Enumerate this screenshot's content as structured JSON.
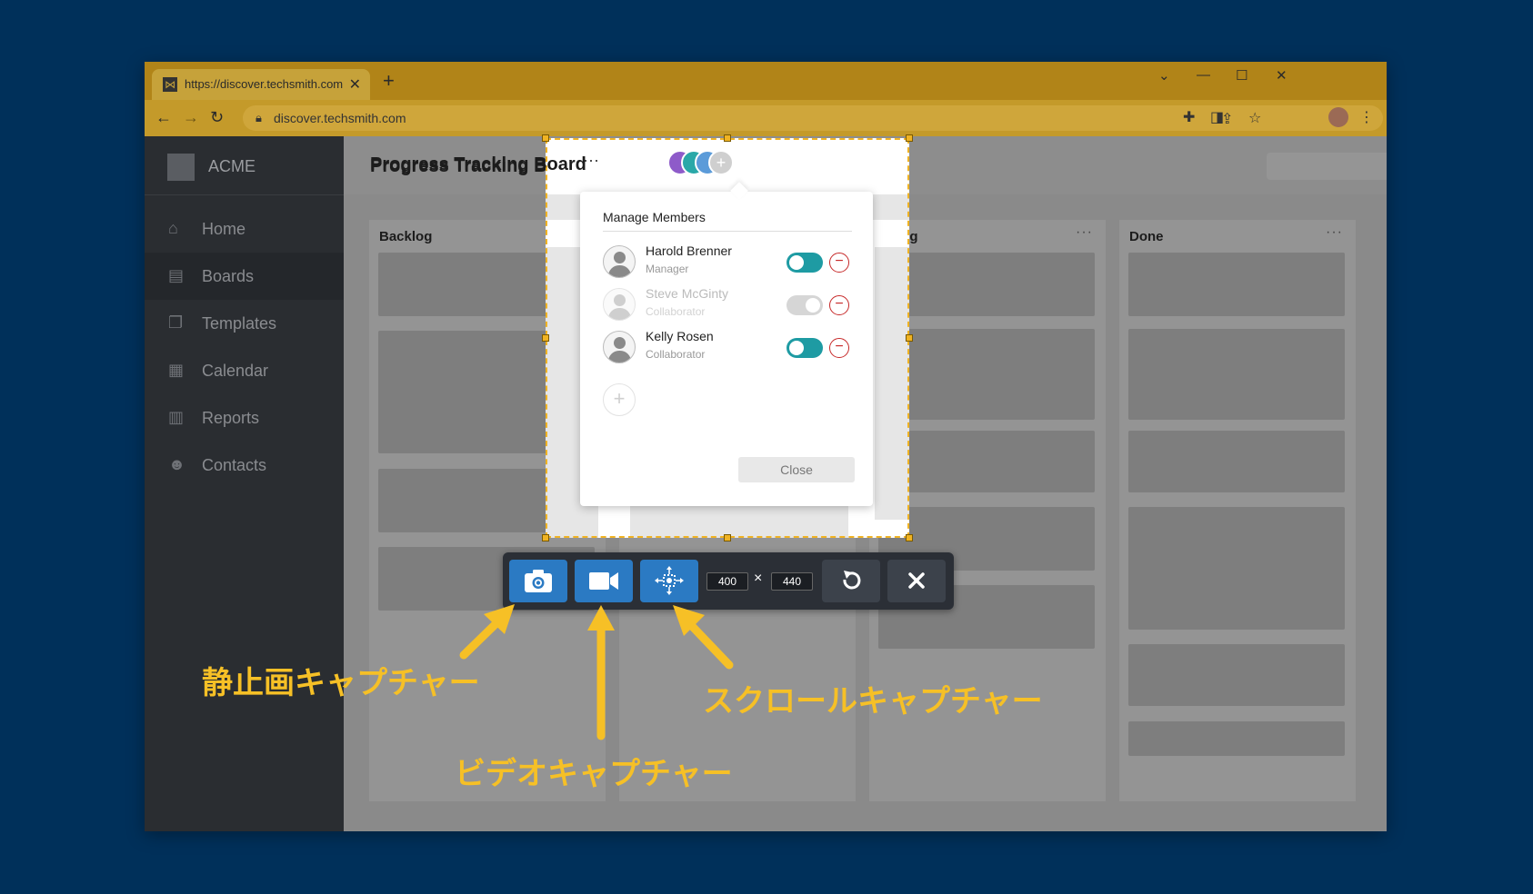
{
  "browser": {
    "tab_title": "https://discover.techsmith.com",
    "tab_close": "✕",
    "new_tab": "+",
    "url": "discover.techsmith.com",
    "window_controls": {
      "dropdown": "⌄",
      "minimize": "—",
      "maximize": "☐",
      "close": "✕"
    }
  },
  "app": {
    "brand": "ACME",
    "sidebar": {
      "items": [
        {
          "label": "Home",
          "icon": "home-icon"
        },
        {
          "label": "Boards",
          "icon": "clipboard-icon"
        },
        {
          "label": "Templates",
          "icon": "templates-icon"
        },
        {
          "label": "Calendar",
          "icon": "calendar-icon"
        },
        {
          "label": "Reports",
          "icon": "document-icon"
        },
        {
          "label": "Contacts",
          "icon": "contacts-icon"
        }
      ]
    },
    "board_title": "Progress Tracking Board",
    "columns": [
      {
        "title": "Backlog",
        "more": ""
      },
      {
        "title": "",
        "more": ""
      },
      {
        "title": "Doing",
        "more": "···"
      },
      {
        "title": "Done",
        "more": "···"
      }
    ]
  },
  "manage_members": {
    "title": "Manage Members",
    "members": [
      {
        "name": "Harold Brenner",
        "role": "Manager",
        "enabled": true
      },
      {
        "name": "Steve McGinty",
        "role": "Collaborator",
        "enabled": false
      },
      {
        "name": "Kelly Rosen",
        "role": "Collaborator",
        "enabled": true
      }
    ],
    "close_label": "Close"
  },
  "capture_toolbar": {
    "width": "400",
    "height": "440",
    "times": "×"
  },
  "annotations": {
    "still_capture": "静止画キャプチャー",
    "video_capture": "ビデオキャプチャー",
    "scroll_capture": "スクロールキャプチャー"
  },
  "colors": {
    "background": "#00305a",
    "accent_yellow": "#f6c026",
    "button_blue": "#2b7ac3",
    "toggle_teal": "#1e9ba3"
  }
}
